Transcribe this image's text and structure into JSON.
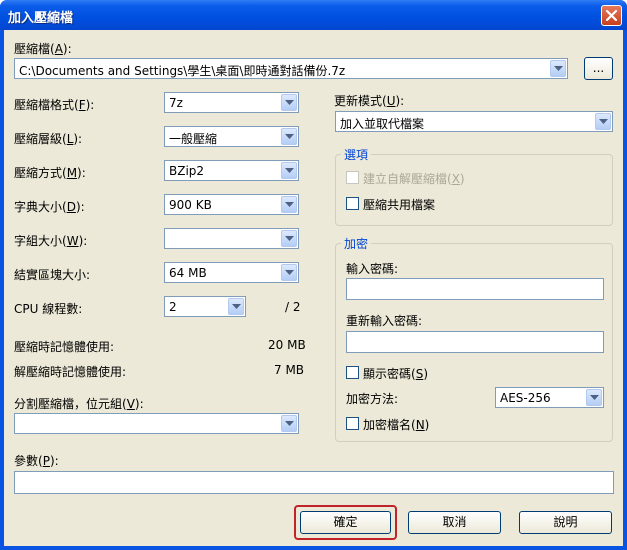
{
  "window": {
    "title": "加入壓縮檔"
  },
  "archive": {
    "label": "壓縮檔(",
    "hotkey": "A",
    "label_end": "):",
    "path": "C:\\Documents and Settings\\學生\\桌面\\即時通對話備份.7z",
    "browse_label": "..."
  },
  "left": {
    "format": {
      "label": "壓縮檔格式(",
      "hotkey": "F",
      "end": "):",
      "value": "7z"
    },
    "level": {
      "label": "壓縮層級(",
      "hotkey": "L",
      "end": "):",
      "value": "一般壓縮"
    },
    "method": {
      "label": "壓縮方式(",
      "hotkey": "M",
      "end": "):",
      "value": "BZip2"
    },
    "dict": {
      "label": "字典大小(",
      "hotkey": "D",
      "end": "):",
      "value": "900 KB"
    },
    "word": {
      "label": "字組大小(",
      "hotkey": "W",
      "end": "):",
      "value": ""
    },
    "solid": {
      "label": "結實區塊大小:",
      "value": "64 MB"
    },
    "threads": {
      "label": "CPU 線程數:",
      "value": "2",
      "max": "/ 2"
    },
    "mem_comp": {
      "label": "壓縮時記憶體使用:",
      "value": "20 MB"
    },
    "mem_decomp": {
      "label": "解壓縮時記憶體使用:",
      "value": "7 MB"
    },
    "split": {
      "label": "分割壓縮檔，位元組(",
      "hotkey": "V",
      "end": "):",
      "value": ""
    }
  },
  "params": {
    "label": "參數(",
    "hotkey": "P",
    "end": "):",
    "value": ""
  },
  "update": {
    "label": "更新模式(",
    "hotkey": "U",
    "end": "):",
    "value": "加入並取代檔案"
  },
  "options": {
    "title": "選項",
    "sfx": {
      "label": "建立自解壓縮檔(",
      "hotkey": "X",
      "end": ")",
      "checked": false,
      "enabled": false
    },
    "shared": {
      "label": "壓縮共用檔案",
      "checked": false
    }
  },
  "encryption": {
    "title": "加密",
    "password_label": "輸入密碼:",
    "password_value": "",
    "reenter_label": "重新輸入密碼:",
    "reenter_value": "",
    "show": {
      "label": "顯示密碼(",
      "hotkey": "S",
      "end": ")",
      "checked": false
    },
    "method_label": "加密方法:",
    "method_value": "AES-256",
    "names": {
      "label": "加密檔名(",
      "hotkey": "N",
      "end": ")",
      "checked": false
    }
  },
  "buttons": {
    "ok": "確定",
    "cancel": "取消",
    "help": "說明"
  },
  "colors": {
    "titlebar": "#0a54e3",
    "dialog_bg": "#ece9d8",
    "group_title": "#0046d5",
    "highlight": "#c0242a"
  },
  "icons": {
    "close": "close-icon",
    "dropdown": "chevron-down-icon"
  }
}
